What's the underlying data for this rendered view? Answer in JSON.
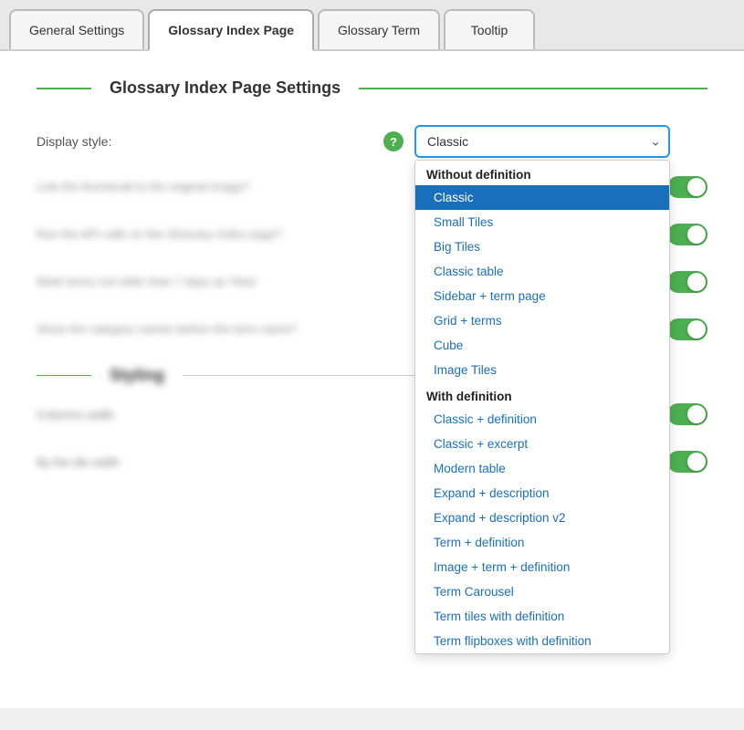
{
  "tabs": [
    {
      "id": "general",
      "label": "General Settings",
      "active": false
    },
    {
      "id": "glossary-index",
      "label": "Glossary Index Page",
      "active": true
    },
    {
      "id": "glossary-term",
      "label": "Glossary Term",
      "active": false
    },
    {
      "id": "tooltip",
      "label": "Tooltip",
      "active": false
    }
  ],
  "section": {
    "title": "Glossary Index Page Settings"
  },
  "displayStyle": {
    "label": "Display style:",
    "currentValue": "Classic",
    "helpIcon": "?"
  },
  "dropdown": {
    "groups": [
      {
        "label": "Without definition",
        "items": [
          {
            "id": "classic",
            "label": "Classic",
            "selected": true
          },
          {
            "id": "small-tiles",
            "label": "Small Tiles",
            "selected": false
          },
          {
            "id": "big-tiles",
            "label": "Big Tiles",
            "selected": false
          },
          {
            "id": "classic-table",
            "label": "Classic table",
            "selected": false
          },
          {
            "id": "sidebar-term-page",
            "label": "Sidebar + term page",
            "selected": false
          },
          {
            "id": "grid-terms",
            "label": "Grid + terms",
            "selected": false
          },
          {
            "id": "cube",
            "label": "Cube",
            "selected": false
          },
          {
            "id": "image-tiles",
            "label": "Image Tiles",
            "selected": false
          }
        ]
      },
      {
        "label": "With definition",
        "items": [
          {
            "id": "classic-definition",
            "label": "Classic + definition",
            "selected": false
          },
          {
            "id": "classic-excerpt",
            "label": "Classic + excerpt",
            "selected": false
          },
          {
            "id": "modern-table",
            "label": "Modern table",
            "selected": false
          },
          {
            "id": "expand-description",
            "label": "Expand + description",
            "selected": false
          },
          {
            "id": "expand-description-v2",
            "label": "Expand + description v2",
            "selected": false
          },
          {
            "id": "term-definition",
            "label": "Term + definition",
            "selected": false
          },
          {
            "id": "image-term-definition",
            "label": "Image + term + definition",
            "selected": false
          },
          {
            "id": "term-carousel",
            "label": "Term Carousel",
            "selected": false
          },
          {
            "id": "term-tiles-definition",
            "label": "Term tiles with definition",
            "selected": false
          },
          {
            "id": "term-flipboxes-definition",
            "label": "Term flipboxes with definition",
            "selected": false
          }
        ]
      }
    ]
  },
  "blurredRows": [
    {
      "id": "row1",
      "text": "Link the thumbnail to the original image?"
    },
    {
      "id": "row2",
      "text": "Run the API calls on the Glossary Index page?"
    },
    {
      "id": "row3",
      "text": "Mark terms not older than 7 days as 'New'"
    },
    {
      "id": "row4",
      "text": "Show the category names before the term name?"
    }
  ],
  "dividerLabel": "Styling",
  "subRows": [
    {
      "id": "sub1",
      "label": "Columns width"
    },
    {
      "id": "sub2",
      "label": "By the tile width"
    }
  ]
}
